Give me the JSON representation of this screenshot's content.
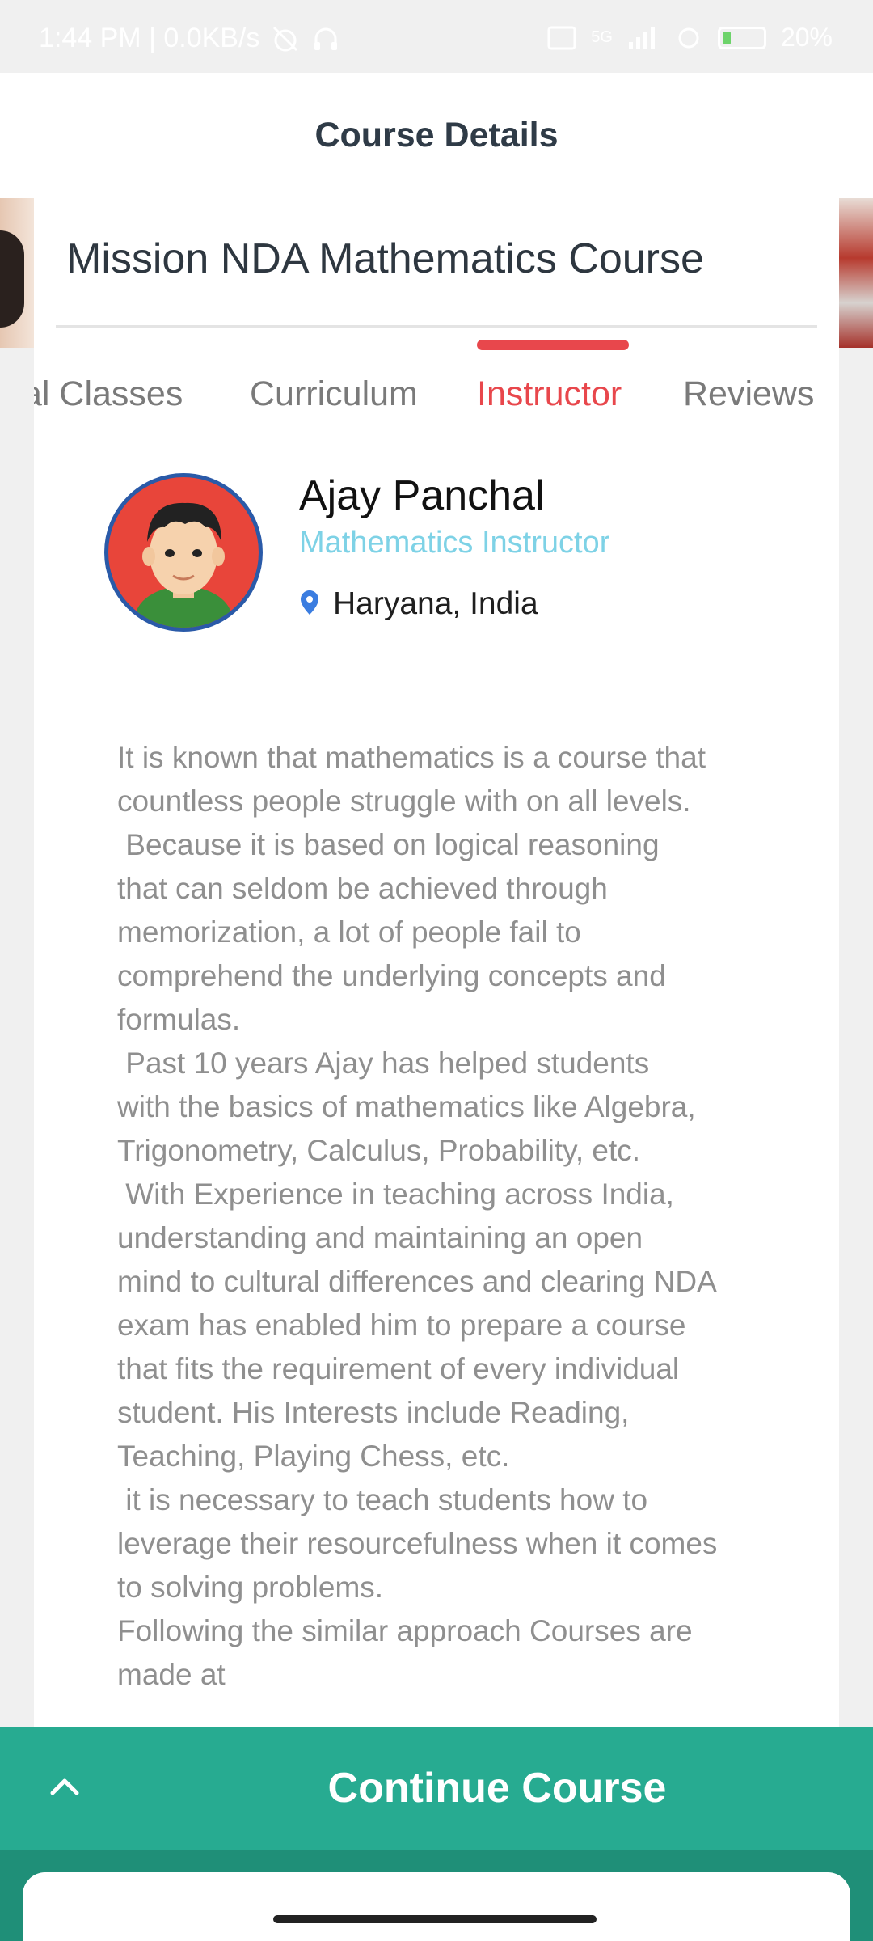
{
  "status_bar": {
    "time_info": "1:44 PM | 0.0KB/s",
    "signal": "5G",
    "battery": "20%"
  },
  "header": {
    "title": "Course Details"
  },
  "course": {
    "title": "Mission NDA Mathematics Course"
  },
  "tabs": [
    {
      "label": "al Classes",
      "active": false
    },
    {
      "label": "Curriculum",
      "active": false
    },
    {
      "label": "Instructor",
      "active": true
    },
    {
      "label": "Reviews",
      "active": false
    }
  ],
  "instructor": {
    "name": "Ajay Panchal",
    "role": "Mathematics Instructor",
    "location": "Haryana, India",
    "avatar_icon": "boy-avatar-icon",
    "location_icon": "location-pin-icon",
    "bio_lines": [
      "It is known that mathematics is a course that",
      "countless people struggle with on all levels.",
      " Because it is based on logical reasoning",
      "that can seldom be achieved through",
      "memorization, a lot of people fail to",
      "comprehend the underlying concepts and",
      "formulas.",
      " Past 10 years Ajay has helped students",
      "with the basics of mathematics like Algebra,",
      "Trigonometry, Calculus, Probability, etc.",
      " With Experience in teaching across India,",
      "understanding and maintaining an open",
      "mind to cultural differences and clearing NDA",
      "exam has enabled him to prepare a course",
      "that fits the requirement of every individual",
      "student. His Interests include Reading,",
      "Teaching, Playing Chess, etc.",
      " it is necessary to teach students how to",
      "leverage their resourcefulness when it comes",
      "to solving problems.",
      "Following the similar approach Courses are",
      "made at"
    ]
  },
  "bottom": {
    "continue_label": "Continue Course",
    "expand_icon": "chevron-up-icon"
  },
  "colors": {
    "accent_red": "#e8474c",
    "role_cyan": "#7ed2e6",
    "continue_green": "#27ab91",
    "bio_gray": "#8f8f8f"
  }
}
